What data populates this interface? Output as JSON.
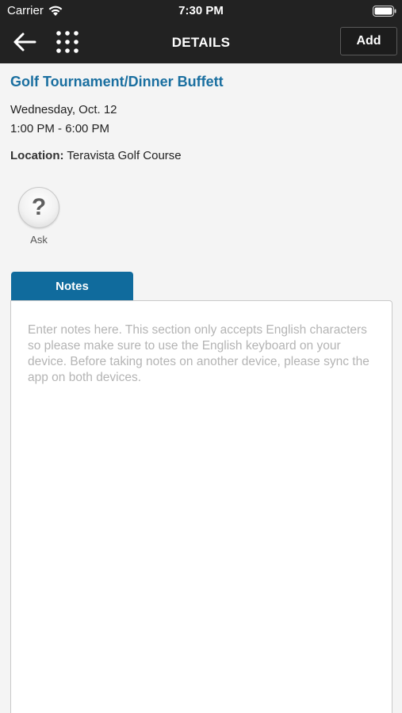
{
  "status_bar": {
    "carrier": "Carrier",
    "time": "7:30 PM",
    "icons": [
      "wifi-icon",
      "battery-icon"
    ]
  },
  "nav": {
    "title": "DETAILS",
    "add_label": "Add",
    "icons": [
      "back-arrow-icon",
      "grid-menu-icon"
    ]
  },
  "event": {
    "title": "Golf Tournament/Dinner Buffett",
    "date": "Wednesday, Oct. 12",
    "time": "1:00 PM - 6:00 PM",
    "location_label": "Location:",
    "location": "Teravista Golf Course"
  },
  "ask": {
    "glyph": "?",
    "label": "Ask",
    "icon": "question-icon"
  },
  "notes": {
    "tab_label": "Notes",
    "value": "",
    "placeholder": "Enter notes here. This section only accepts English characters so please make sure to use the English keyboard on your device. Before taking notes on another device, please sync the app on both devices."
  },
  "colors": {
    "header_bg": "#222222",
    "accent_title": "#1a6fa0",
    "notes_tab": "#106b9d",
    "page_bg": "#f4f4f4"
  }
}
